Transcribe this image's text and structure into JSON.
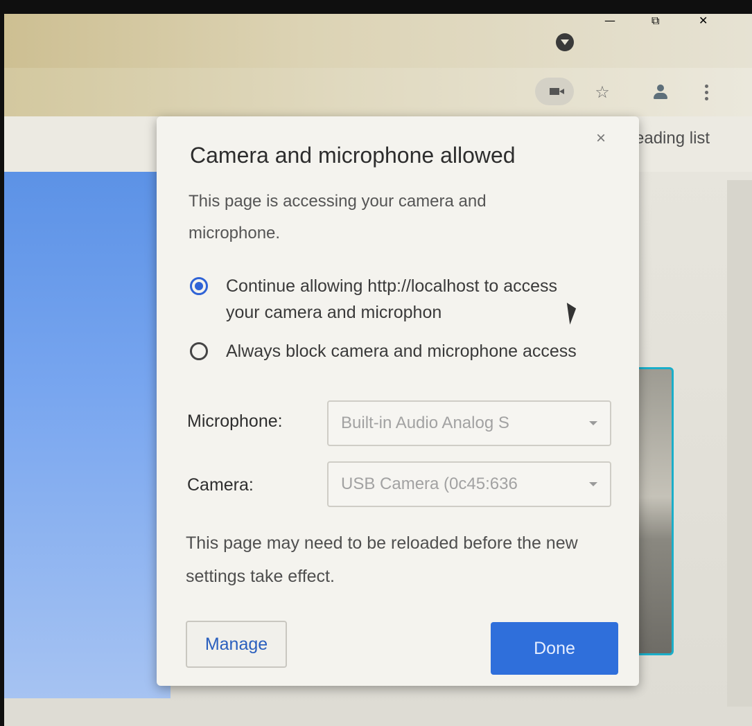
{
  "window": {
    "minimize_glyph": "—",
    "restore_glyph": "⧉",
    "close_glyph": "✕"
  },
  "toolbar": {
    "bookmark_glyph": "☆"
  },
  "bookmarks_bar": {
    "reading_list_partial": "eading list"
  },
  "dialog": {
    "close_glyph": "×",
    "title": "Camera and microphone allowed",
    "description": "This page is accessing your camera and microphone.",
    "options": [
      {
        "label": "Continue allowing http://localhost to access your camera and microphon",
        "checked": true
      },
      {
        "label": "Always block camera and microphone access",
        "checked": false
      }
    ],
    "microphone": {
      "label": "Microphone:",
      "value": "Built-in Audio Analog S"
    },
    "camera": {
      "label": "Camera:",
      "value": "USB Camera (0c45:636"
    },
    "note": "This page may need to be reloaded before the new settings take effect.",
    "manage_label": "Manage",
    "done_label": "Done"
  },
  "colors": {
    "accent": "#2f6fdb",
    "radio_selected": "#2f63d6",
    "page_blue": "#6b9cea"
  }
}
